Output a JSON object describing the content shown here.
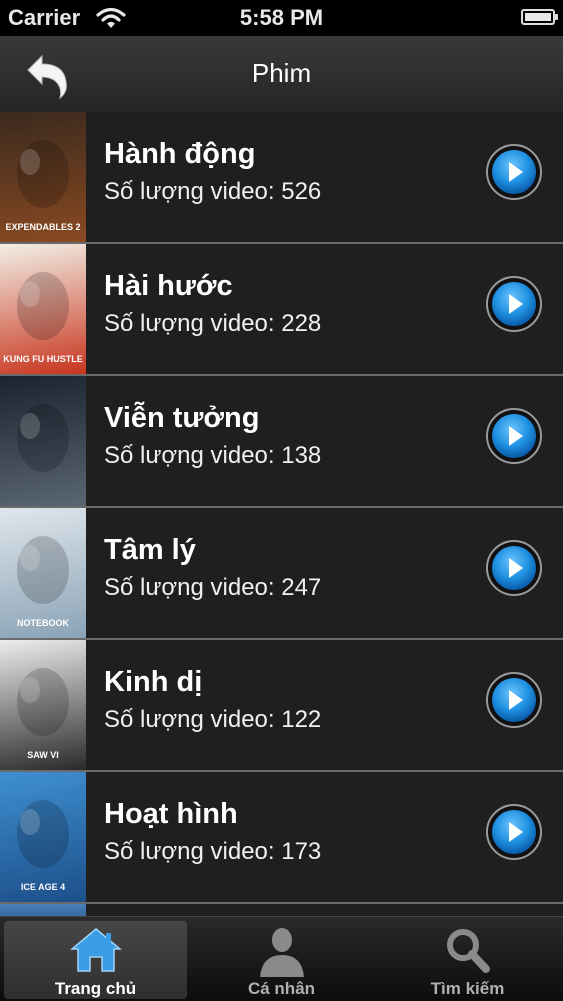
{
  "status_bar": {
    "carrier": "Carrier",
    "time": "5:58 PM"
  },
  "nav": {
    "title": "Phim"
  },
  "categories": [
    {
      "name": "Hành động",
      "count_text": "Số lượng video: 526",
      "poster_text": "EXPENDABLES 2",
      "poster_colors": [
        "#3b2a1e",
        "#8a4a22"
      ]
    },
    {
      "name": "Hài hước",
      "count_text": "Số lượng video: 228",
      "poster_text": "KUNG FU HUSTLE",
      "poster_colors": [
        "#f2efe6",
        "#c8351e"
      ]
    },
    {
      "name": "Viễn tưởng",
      "count_text": "Số lượng video: 138",
      "poster_text": "",
      "poster_colors": [
        "#1a2430",
        "#5a6672"
      ]
    },
    {
      "name": "Tâm lý",
      "count_text": "Số lượng video: 247",
      "poster_text": "NOTEBOOK",
      "poster_colors": [
        "#dfe6ec",
        "#8aa3b6"
      ]
    },
    {
      "name": "Kinh dị",
      "count_text": "Số lượng video: 122",
      "poster_text": "SAW VI",
      "poster_colors": [
        "#ededed",
        "#2a2a2a"
      ]
    },
    {
      "name": "Hoạt hình",
      "count_text": "Số lượng video: 173",
      "poster_text": "ICE AGE 4",
      "poster_colors": [
        "#3f8fd0",
        "#1c4f8a"
      ]
    }
  ],
  "tabs": [
    {
      "label": "Trang chủ",
      "icon": "home-icon",
      "active": true
    },
    {
      "label": "Cá nhân",
      "icon": "person-icon",
      "active": false
    },
    {
      "label": "Tìm kiếm",
      "icon": "search-icon",
      "active": false
    }
  ],
  "colors": {
    "accent_blue": "#1e8fe0",
    "row_bg": "#1f1f1f",
    "divider": "#6a6a6a"
  }
}
